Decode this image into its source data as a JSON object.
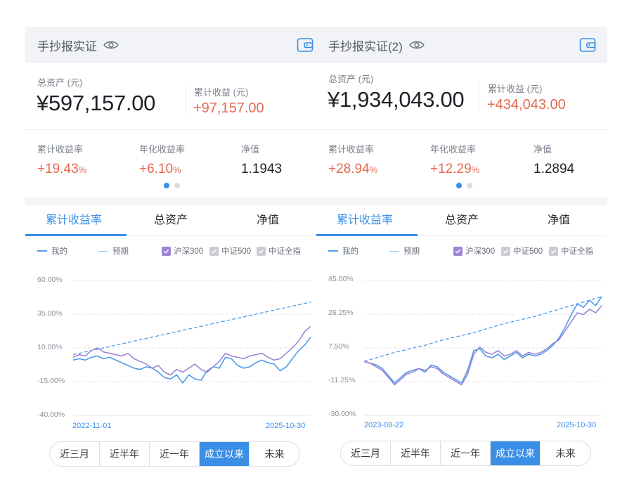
{
  "panels": [
    {
      "header": {
        "title": "手抄报实证"
      },
      "assets": {
        "total_label": "总资产 (元)",
        "total_value": "¥597,157.00",
        "profit_label": "累计收益 (元)",
        "profit_value": "+97,157.00"
      },
      "stats": [
        {
          "label": "累计收益率",
          "value": "+19.43",
          "unit": "%",
          "color": "red"
        },
        {
          "label": "年化收益率",
          "value": "+6.10",
          "unit": "%",
          "color": "red"
        },
        {
          "label": "净值",
          "value": "1.1943",
          "unit": "",
          "color": "dark"
        }
      ],
      "tabs": [
        "累计收益率",
        "总资产",
        "净值"
      ],
      "legend": {
        "mine": "我的",
        "expected": "预期",
        "cb1": "沪深300",
        "cb2": "中证500",
        "cb3": "中证全指"
      },
      "chart_data": {
        "type": "line",
        "y_ticks": [
          "60.00%",
          "35.00%",
          "10.00%",
          "-15.00%",
          "-40.00%"
        ],
        "ylim": [
          -40,
          60
        ],
        "x_start": "2022-11-01",
        "x_end": "2025-10-30",
        "series": [
          {
            "name": "我的",
            "color": "#4c9be8",
            "values": [
              1,
              2,
              1,
              3,
              4,
              2,
              3,
              1,
              -1,
              -3,
              -5,
              -6,
              -4,
              -5,
              -8,
              -12,
              -13,
              -10,
              -16,
              -10,
              -13,
              -14,
              -7,
              -4,
              -5,
              3,
              2,
              -3,
              -5,
              -4,
              -1,
              1,
              -1,
              -2,
              -7,
              -4,
              2,
              8,
              12,
              18
            ]
          },
          {
            "name": "沪深300",
            "color": "#9c84d8",
            "values": [
              3,
              5,
              4,
              8,
              10,
              7,
              6,
              5,
              4,
              6,
              2,
              0,
              -2,
              -5,
              -3,
              -8,
              -10,
              -6,
              -8,
              -5,
              -2,
              -6,
              -8,
              -4,
              0,
              6,
              4,
              3,
              2,
              4,
              5,
              6,
              3,
              1,
              2,
              6,
              10,
              15,
              22,
              26
            ]
          },
          {
            "name": "预期",
            "color": "#4c9be8",
            "dashed": true,
            "values": [
              5,
              6,
              7,
              8,
              9,
              10,
              11,
              12,
              13,
              14,
              15,
              16,
              17,
              18,
              19,
              20,
              21,
              22,
              23,
              24,
              25,
              26,
              27,
              28,
              29,
              30,
              31,
              32,
              33,
              34,
              35,
              36,
              37,
              38,
              39,
              40,
              41,
              42,
              43,
              44
            ]
          }
        ]
      },
      "ranges": [
        "近三月",
        "近半年",
        "近一年",
        "成立以来",
        "未来"
      ],
      "active_range": 3
    },
    {
      "header": {
        "title": "手抄报实证(2)"
      },
      "assets": {
        "total_label": "总资产 (元)",
        "total_value": "¥1,934,043.00",
        "profit_label": "累计收益 (元)",
        "profit_value": "+434,043.00"
      },
      "stats": [
        {
          "label": "累计收益率",
          "value": "+28.94",
          "unit": "%",
          "color": "red"
        },
        {
          "label": "年化收益率",
          "value": "+12.29",
          "unit": "%",
          "color": "red"
        },
        {
          "label": "净值",
          "value": "1.2894",
          "unit": "",
          "color": "dark"
        }
      ],
      "tabs": [
        "累计收益率",
        "总资产",
        "净值"
      ],
      "legend": {
        "mine": "我的",
        "expected": "预期",
        "cb1": "沪深300",
        "cb2": "中证500",
        "cb3": "中证全指"
      },
      "chart_data": {
        "type": "line",
        "y_ticks": [
          "45.00%",
          "26.25%",
          "7.50%",
          "-11.25%",
          "-30.00%"
        ],
        "ylim": [
          -30,
          45
        ],
        "x_start": "2023-08-22",
        "x_end": "2025-10-30",
        "series": [
          {
            "name": "我的",
            "color": "#4c9be8",
            "values": [
              0,
              -1,
              -2,
              -4,
              -8,
              -12,
              -9,
              -6,
              -5,
              -4,
              -6,
              -2,
              -3,
              -6,
              -8,
              -10,
              -12,
              -5,
              6,
              7,
              3,
              2,
              4,
              1,
              3,
              5,
              2,
              4,
              3,
              4,
              6,
              9,
              13,
              19,
              26,
              32,
              30,
              34,
              31,
              36
            ]
          },
          {
            "name": "沪深300",
            "color": "#9c84d8",
            "values": [
              0,
              -1,
              -3,
              -5,
              -9,
              -13,
              -10,
              -7,
              -6,
              -4,
              -5,
              -3,
              -4,
              -7,
              -9,
              -11,
              -13,
              -7,
              4,
              8,
              5,
              4,
              6,
              3,
              4,
              6,
              3,
              5,
              4,
              5,
              7,
              10,
              12,
              17,
              22,
              27,
              26,
              29,
              27,
              31
            ]
          },
          {
            "name": "预期",
            "color": "#4c9be8",
            "dashed": true,
            "values": [
              0,
              1,
              2,
              3,
              4,
              5,
              5.8,
              6.6,
              7.4,
              8.2,
              9,
              10,
              11,
              12,
              12.8,
              13.6,
              14.4,
              15.2,
              16,
              17,
              18,
              19,
              20,
              21,
              21.8,
              22.6,
              23.4,
              24.2,
              25,
              26,
              27,
              28,
              29,
              30,
              31,
              32,
              33,
              34,
              35,
              36
            ]
          }
        ]
      },
      "ranges": [
        "近三月",
        "近半年",
        "近一年",
        "成立以来",
        "未来"
      ],
      "active_range": 3
    }
  ]
}
